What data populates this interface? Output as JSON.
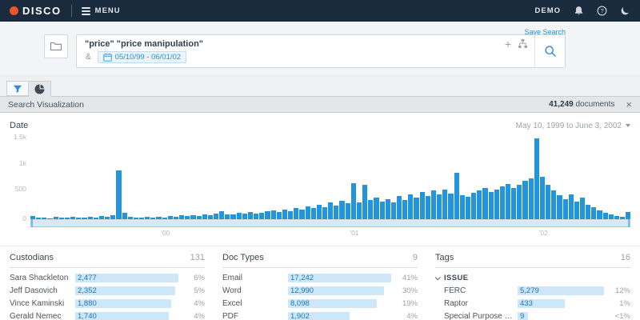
{
  "navbar": {
    "brand": "DISCO",
    "menu": "MENU",
    "account": "DEMO"
  },
  "search": {
    "save_search": "Save Search",
    "query": "\"price\" \"price manipulation\"",
    "operator": "&",
    "date_range": "05/10/99 - 06/01/02"
  },
  "panel": {
    "title": "Search Visualization",
    "count": "41,249",
    "count_suffix": "documents",
    "close": "×"
  },
  "date": {
    "label": "Date",
    "range": "May 10, 1999 to June 3, 2002"
  },
  "chart_data": {
    "type": "bar",
    "title": "Date",
    "subtitle": "Document count by date, May 10, 1999 to June 3, 2002",
    "ylim": [
      0,
      1500
    ],
    "yticks": [
      "1.5k",
      "1k",
      "500",
      "0"
    ],
    "xticks": [
      "'00",
      "'01",
      "'02"
    ],
    "legend": "none",
    "grid": "off",
    "values": [
      55,
      25,
      35,
      20,
      40,
      25,
      30,
      45,
      25,
      35,
      50,
      30,
      60,
      45,
      70,
      870,
      120,
      45,
      30,
      25,
      40,
      30,
      45,
      35,
      55,
      45,
      65,
      55,
      75,
      60,
      85,
      70,
      95,
      150,
      80,
      90,
      110,
      95,
      130,
      105,
      120,
      145,
      160,
      130,
      175,
      150,
      200,
      170,
      230,
      195,
      260,
      220,
      300,
      250,
      330,
      280,
      650,
      300,
      620,
      340,
      380,
      310,
      360,
      300,
      420,
      350,
      450,
      390,
      480,
      420,
      510,
      440,
      530,
      460,
      830,
      430,
      400,
      470,
      520,
      560,
      480,
      530,
      590,
      630,
      560,
      610,
      680,
      730,
      1450,
      760,
      620,
      510,
      430,
      360,
      450,
      310,
      380,
      260,
      210,
      160,
      120,
      90,
      60,
      40,
      130
    ]
  },
  "facets": [
    {
      "title": "Custodians",
      "count": "131",
      "rows": [
        {
          "label": "Sara Shackleton",
          "value": "2,477",
          "pct": "6%",
          "bar_pct": 100
        },
        {
          "label": "Jeff Dasovich",
          "value": "2,352",
          "pct": "5%",
          "bar_pct": 97
        },
        {
          "label": "Vince Kaminski",
          "value": "1,880",
          "pct": "4%",
          "bar_pct": 93
        },
        {
          "label": "Gerald Nemec",
          "value": "1,740",
          "pct": "4%",
          "bar_pct": 91
        }
      ]
    },
    {
      "title": "Doc Types",
      "count": "9",
      "rows": [
        {
          "label": "Email",
          "value": "17,242",
          "pct": "41%",
          "bar_pct": 100
        },
        {
          "label": "Word",
          "value": "12,990",
          "pct": "30%",
          "bar_pct": 93
        },
        {
          "label": "Excel",
          "value": "8,098",
          "pct": "19%",
          "bar_pct": 86
        },
        {
          "label": "PDF",
          "value": "1,902",
          "pct": "4%",
          "bar_pct": 60
        }
      ]
    },
    {
      "title": "Tags",
      "count": "16",
      "group": "ISSUE",
      "rows": [
        {
          "label": "FERC",
          "value": "5,279",
          "pct": "12%",
          "bar_pct": 100
        },
        {
          "label": "Raptor",
          "value": "433",
          "pct": "1%",
          "bar_pct": 55
        },
        {
          "label": "Special Purpose V...",
          "value": "9",
          "pct": "<1%",
          "bar_pct": 12
        }
      ]
    }
  ]
}
